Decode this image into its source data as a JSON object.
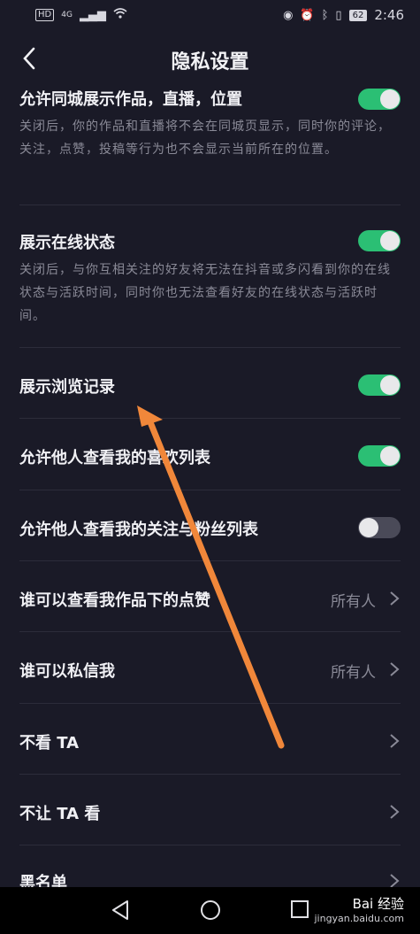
{
  "status_bar": {
    "network": "HD",
    "signal_label": "4G",
    "battery": "62",
    "time": "2:46"
  },
  "header": {
    "title": "隐私设置"
  },
  "settings": [
    {
      "title": "允许同城展示作品，直播，位置",
      "description": "关闭后，你的作品和直播将不会在同城页显示，同时你的评论，关注，点赞，投稿等行为也不会显示当前所在的位置。",
      "toggle": true
    },
    {
      "title": "展示在线状态",
      "description": "关闭后，与你互相关注的好友将无法在抖音或多闪看到你的在线状态与活跃时间，同时你也无法查看好友的在线状态与活跃时间。",
      "toggle": true
    },
    {
      "title": "展示浏览记录",
      "toggle": true
    },
    {
      "title": "允许他人查看我的喜欢列表",
      "toggle": true
    },
    {
      "title": "允许他人查看我的关注与粉丝列表",
      "toggle": false
    },
    {
      "title": "谁可以查看我作品下的点赞",
      "value": "所有人"
    },
    {
      "title": "谁可以私信我",
      "value": "所有人"
    },
    {
      "title": "不看 TA"
    },
    {
      "title": "不让 TA 看"
    },
    {
      "title": "黑名单"
    }
  ],
  "watermark": {
    "brand": "Bai 经验",
    "sub": "jingyan.baidu.com"
  },
  "colors": {
    "toggle_on": "#2bbf74",
    "toggle_off": "#4a4a58",
    "background": "#1a1a27",
    "arrow": "#f0873a"
  }
}
